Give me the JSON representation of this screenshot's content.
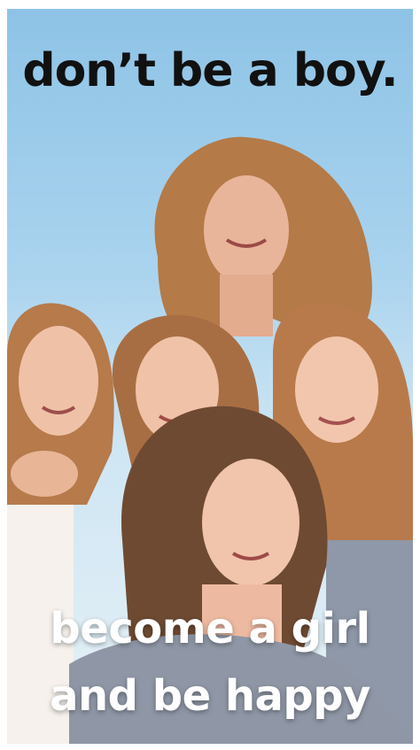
{
  "headline": "don’t be a boy.",
  "caption": {
    "line1": "become a girl",
    "line2": "and be happy"
  },
  "colors": {
    "sky_top": "#8ec3e6",
    "sky_bottom": "#e7f1f6",
    "hair": "#b97a4a",
    "headline_text": "#111111",
    "caption_text": "#ffffff"
  }
}
